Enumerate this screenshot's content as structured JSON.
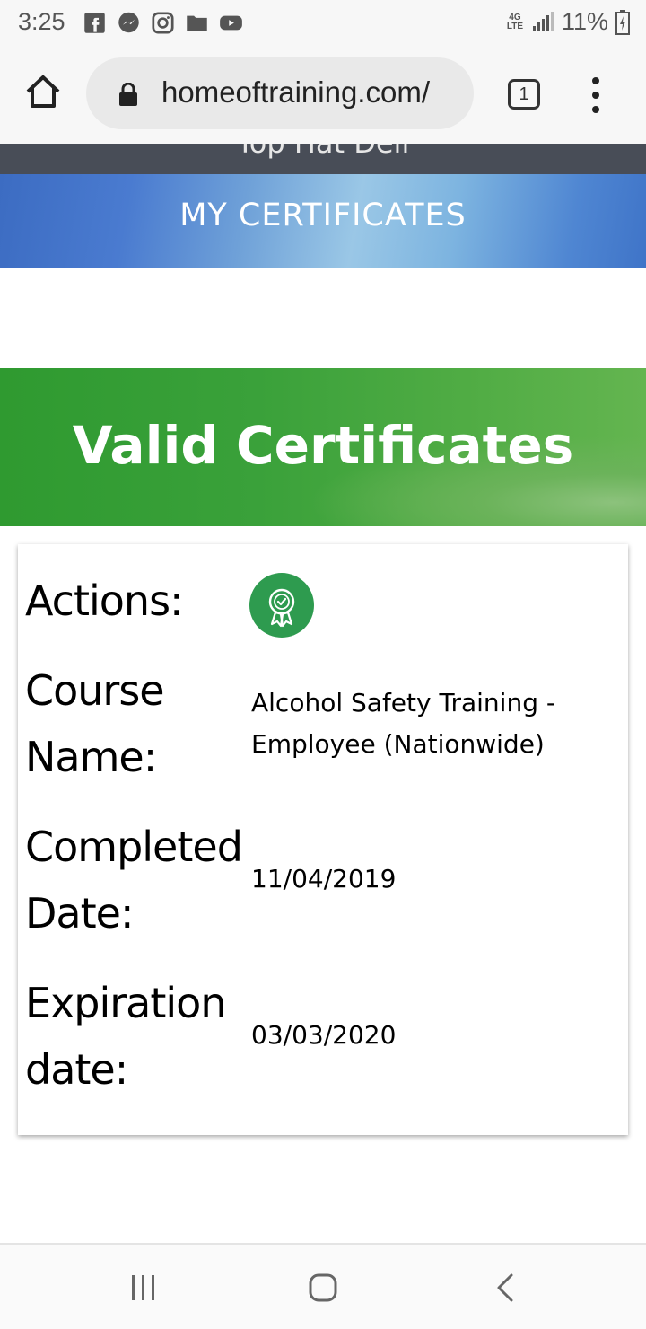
{
  "status_bar": {
    "time": "3:25",
    "network_type": "4G LTE",
    "battery": "11%"
  },
  "browser": {
    "url": "homeoftraining.com/",
    "tab_count": "1"
  },
  "site": {
    "nav_partial_text": "Top Hat Deli",
    "page_banner": "MY CERTIFICATES",
    "section_title": "Valid Certificates"
  },
  "certificate": {
    "actions_label": "Actions:",
    "course_label": "Course Name:",
    "course_name": "Alcohol Safety Training - Employee (Nationwide)",
    "completed_label": "Completed Date:",
    "completed_date": "11/04/2019",
    "expiration_label": "Expiration date:",
    "expiration_date": "03/03/2020"
  },
  "colors": {
    "accent_green": "#2e9b4f",
    "banner_blue": "#4a7bd0",
    "nav_dark": "#484d57"
  },
  "icons": [
    "facebook-icon",
    "messenger-icon",
    "instagram-icon",
    "folder-icon",
    "youtube-icon",
    "signal-icon",
    "battery-icon",
    "home-icon",
    "lock-icon",
    "more-vert-icon",
    "certificate-badge-icon",
    "recents-icon",
    "home-nav-icon",
    "back-icon"
  ]
}
